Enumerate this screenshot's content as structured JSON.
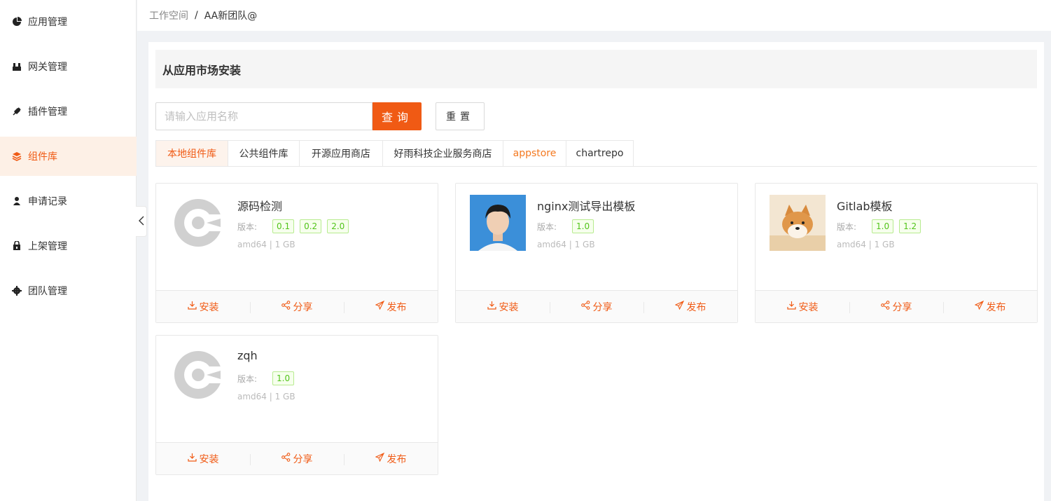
{
  "sidebar": {
    "items": [
      {
        "label": "应用管理",
        "icon": "pie-chart-icon"
      },
      {
        "label": "网关管理",
        "icon": "gateway-icon"
      },
      {
        "label": "插件管理",
        "icon": "plugin-icon"
      },
      {
        "label": "组件库",
        "icon": "layers-icon"
      },
      {
        "label": "申请记录",
        "icon": "user-icon"
      },
      {
        "label": "上架管理",
        "icon": "lock-bag-icon"
      },
      {
        "label": "团队管理",
        "icon": "gear-icon"
      }
    ],
    "active_index": 3
  },
  "breadcrumb": {
    "workspace": "工作空间",
    "separator": "/",
    "team": "AA新团队@"
  },
  "panel": {
    "title": "从应用市场安装",
    "search_placeholder": "请输入应用名称",
    "query_label": "查询",
    "reset_label": "重置"
  },
  "tabs": [
    {
      "label": "本地组件库",
      "active": true
    },
    {
      "label": "公共组件库"
    },
    {
      "label": "开源应用商店"
    },
    {
      "label": "好雨科技企业服务商店"
    },
    {
      "label": "appstore"
    },
    {
      "label": "chartrepo"
    }
  ],
  "cards": [
    {
      "name": "源码检测",
      "version_label": "版本:",
      "versions": [
        "0.1",
        "0.2",
        "2.0"
      ],
      "meta": "amd64 | 1 GB",
      "image": "default-logo"
    },
    {
      "name": "nginx测试导出模板",
      "version_label": "版本:",
      "versions": [
        "1.0"
      ],
      "meta": "amd64 | 1 GB",
      "image": "portrait-photo"
    },
    {
      "name": "Gitlab模板",
      "version_label": "版本:",
      "versions": [
        "1.0",
        "1.2"
      ],
      "meta": "amd64 | 1 GB",
      "image": "shiba-dog-photo"
    },
    {
      "name": "zqh",
      "version_label": "版本:",
      "versions": [
        "1.0"
      ],
      "meta": "amd64 | 1 GB",
      "image": "default-logo"
    }
  ],
  "card_actions": {
    "install": "安装",
    "share": "分享",
    "publish": "发布"
  },
  "colors": {
    "accent": "#f05a14",
    "active_bg": "#fdf0e6",
    "version_green": "#52c41a"
  }
}
